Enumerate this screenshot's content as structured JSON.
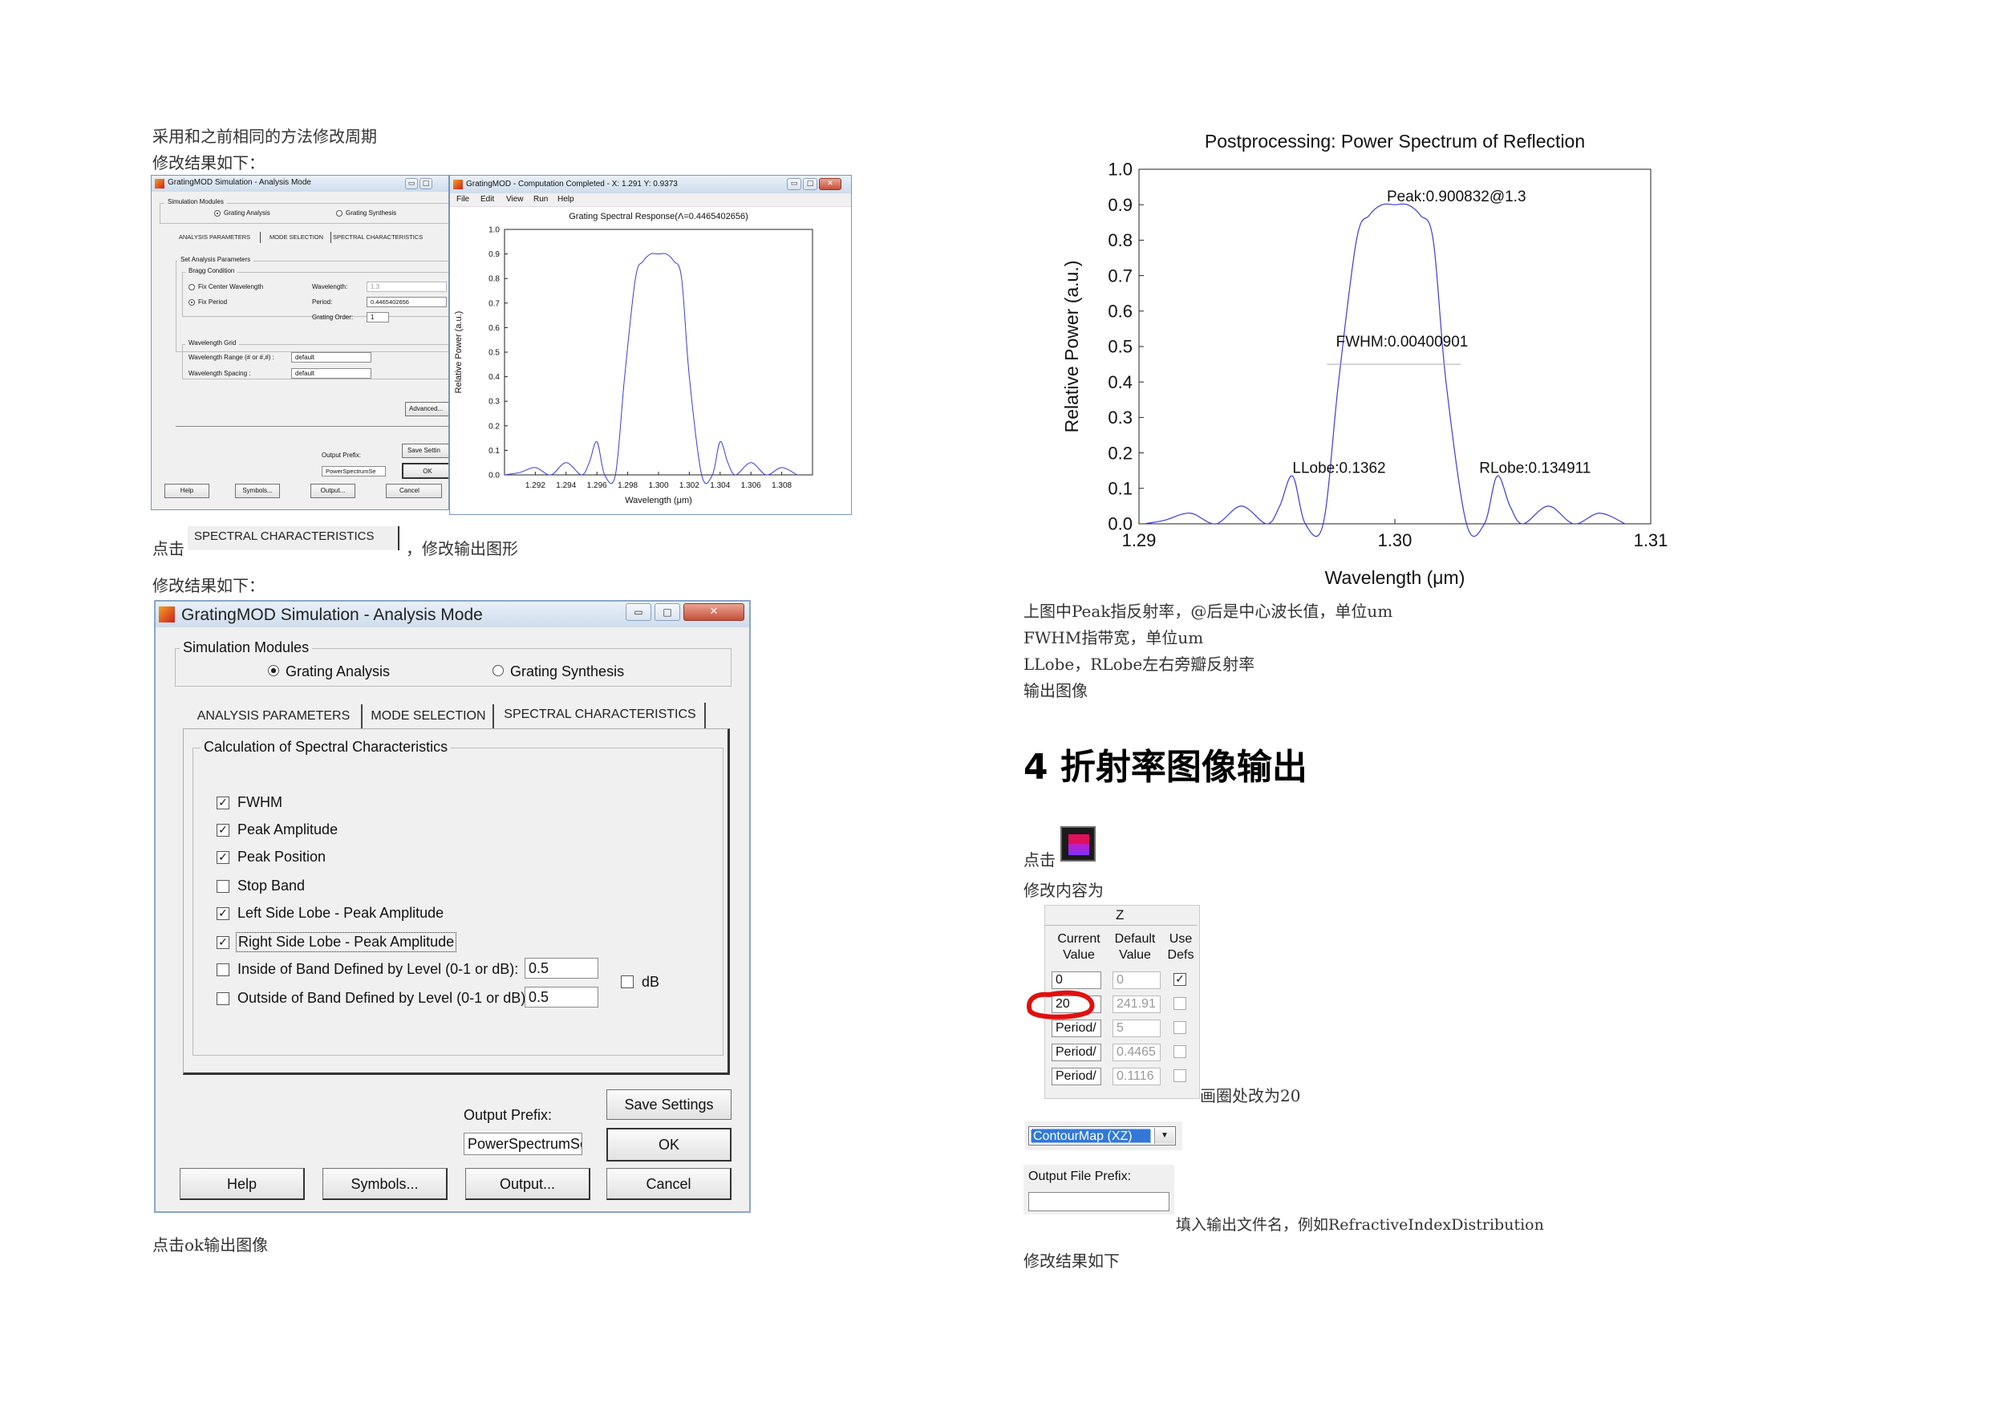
{
  "left": {
    "para1": "采用和之前相同的方法修改周期",
    "para2": "修改结果如下：",
    "click_prefix": "点击",
    "spectral_button": "SPECTRAL CHARACTERISTICS",
    "click_suffix": "，修改输出图形",
    "para3": "修改结果如下：",
    "para4": "点击ok输出图像"
  },
  "small_analysis_window": {
    "title": "GratingMOD Simulation - Analysis Mode",
    "modules_label": "Simulation Modules",
    "radio_analysis": "Grating Analysis",
    "radio_synthesis": "Grating Synthesis",
    "tabs": [
      "ANALYSIS PARAMETERS",
      "MODE SELECTION",
      "SPECTRAL CHARACTERISTICS"
    ],
    "set_params": "Set Analysis Parameters",
    "bragg": "Bragg Condition",
    "fix_center": "Fix Center Wavelength",
    "fix_period": "Fix Period",
    "wavelength_label": "Wavelength:",
    "wavelength_value": "1.3",
    "period_label": "Period:",
    "period_value": "0.4465402656",
    "order_label": "Grating Order:",
    "order_value": "1",
    "grid_label": "Wavelength Grid",
    "range_label": "Wavelength Range (# or #,#) :",
    "range_value": "default",
    "spacing_label": "Wavelength Spacing :",
    "spacing_value": "default",
    "advanced": "Advanced...",
    "output_prefix_label": "Output Prefix:",
    "output_prefix_value": "PowerSpectrumSe",
    "save": "Save Settin",
    "ok": "OK",
    "help": "Help",
    "symbols": "Symbols...",
    "output": "Output...",
    "cancel": "Cancel"
  },
  "computation_window": {
    "title": "GratingMOD - Computation Completed - X: 1.291  Y: 0.9373",
    "menu": [
      "File",
      "Edit",
      "View",
      "Run",
      "Help"
    ],
    "chart_title": "Grating Spectral Response(Λ=0.4465402656)",
    "xlabel": "Wavelength (μm)",
    "ylabel": "Relative Power (a.u.)"
  },
  "big_window": {
    "title": "GratingMOD Simulation - Analysis Mode",
    "modules_label": "Simulation Modules",
    "radio_analysis": "Grating Analysis",
    "radio_synthesis": "Grating Synthesis",
    "tabs": [
      "ANALYSIS PARAMETERS",
      "MODE SELECTION",
      "SPECTRAL CHARACTERISTICS"
    ],
    "calc_label": "Calculation of Spectral Characteristics",
    "checks": [
      {
        "label": "FWHM",
        "checked": true
      },
      {
        "label": "Peak Amplitude",
        "checked": true
      },
      {
        "label": "Peak Position",
        "checked": true
      },
      {
        "label": "Stop Band",
        "checked": false
      },
      {
        "label": "Left Side Lobe - Peak Amplitude",
        "checked": true
      },
      {
        "label": "Right Side Lobe - Peak Amplitude",
        "checked": true
      },
      {
        "label": "Inside of Band Defined by Level (0-1 or dB):",
        "checked": false
      },
      {
        "label": "Outside of Band Defined by Level (0-1 or dB):",
        "checked": false
      }
    ],
    "inside_value": "0.5",
    "outside_value": "0.5",
    "db_label": "dB",
    "output_prefix_label": "Output Prefix:",
    "output_prefix_value": "PowerSpectrumSe",
    "save": "Save Settings",
    "ok": "OK",
    "help": "Help",
    "symbols": "Symbols...",
    "output": "Output...",
    "cancel": "Cancel"
  },
  "right": {
    "note1": "上图中Peak指反射率，@后是中心波长值，单位um",
    "note2": "FWHM指带宽，单位um",
    "note3": "LLobe，RLobe左右旁瓣反射率",
    "note4": "输出图像",
    "heading": "4 折射率图像输出",
    "click_prefix": "点击",
    "modify": "修改内容为",
    "circle_note": "画圈处改为20",
    "dropdown_value": "ContourMap (XZ)",
    "output_file_label": "Output File Prefix:",
    "fill_note": "填入输出文件名，例如RefractiveIndexDistribution",
    "result": "修改结果如下"
  },
  "z_table": {
    "title": "Z",
    "headers": [
      "Current Value",
      "Default Value",
      "Use Defs"
    ],
    "rows": [
      {
        "current": "0",
        "default": "0",
        "use": true
      },
      {
        "current": "20",
        "default": "241.91",
        "use": false
      },
      {
        "current": "Period/",
        "default": "5",
        "use": false
      },
      {
        "current": "Period/",
        "default": "0.4465",
        "use": false
      },
      {
        "current": "Period/",
        "default": "0.1116",
        "use": false
      }
    ]
  },
  "chart_data": [
    {
      "type": "line",
      "title": "Grating Spectral Response(Λ=0.4465402656)",
      "xlabel": "Wavelength (μm)",
      "ylabel": "Relative Power (a.u.)",
      "xlim": [
        1.29,
        1.31
      ],
      "ylim": [
        0,
        1.0
      ],
      "xticks": [
        "1.292",
        "1.294",
        "1.296",
        "1.298",
        "1.300",
        "1.302",
        "1.304",
        "1.306",
        "1.308"
      ],
      "yticks": [
        "0.0",
        "0.1",
        "0.2",
        "0.3",
        "0.4",
        "0.5",
        "0.6",
        "0.7",
        "0.8",
        "0.9",
        "1.0"
      ],
      "color": "#3b3bdc",
      "x": [
        1.29,
        1.291,
        1.292,
        1.293,
        1.294,
        1.295,
        1.2955,
        1.296,
        1.2965,
        1.2972,
        1.2978,
        1.2985,
        1.299,
        1.2995,
        1.3,
        1.3005,
        1.301,
        1.3015,
        1.302,
        1.3028,
        1.3035,
        1.304,
        1.3045,
        1.305,
        1.306,
        1.307,
        1.308,
        1.309
      ],
      "y": [
        0.0,
        0.01,
        0.03,
        0.0,
        0.05,
        0.0,
        0.05,
        0.135,
        0.0,
        0.0,
        0.4,
        0.8,
        0.87,
        0.9,
        0.9,
        0.9,
        0.87,
        0.8,
        0.4,
        0.0,
        0.0,
        0.135,
        0.05,
        0.0,
        0.05,
        0.0,
        0.03,
        0.0
      ]
    },
    {
      "type": "line",
      "title": "Postprocessing: Power Spectrum of Reflection",
      "xlabel": "Wavelength (μm)",
      "ylabel": "Relative Power (a.u.)",
      "xlim": [
        1.29,
        1.31
      ],
      "ylim": [
        0.0,
        1.0
      ],
      "xticks": [
        "1.29",
        "1.30",
        "1.31"
      ],
      "yticks": [
        "0.0",
        "0.1",
        "0.2",
        "0.3",
        "0.4",
        "0.5",
        "0.6",
        "0.7",
        "0.8",
        "0.9",
        "1.0"
      ],
      "color": "#3b3bdc",
      "x": [
        1.2902,
        1.291,
        1.292,
        1.293,
        1.294,
        1.295,
        1.2955,
        1.296,
        1.2965,
        1.2972,
        1.2978,
        1.2985,
        1.299,
        1.2995,
        1.3,
        1.3005,
        1.301,
        1.3015,
        1.302,
        1.3028,
        1.3035,
        1.304,
        1.3045,
        1.305,
        1.306,
        1.307,
        1.308,
        1.309
      ],
      "y": [
        0.0,
        0.01,
        0.03,
        0.0,
        0.05,
        0.0,
        0.05,
        0.135,
        0.0,
        0.0,
        0.4,
        0.8,
        0.87,
        0.9,
        0.9,
        0.9,
        0.87,
        0.8,
        0.4,
        0.0,
        0.0,
        0.135,
        0.05,
        0.0,
        0.05,
        0.0,
        0.03,
        0.0
      ],
      "annotations": [
        "Peak:0.900832@1.3",
        "FWHM:0.00400901",
        "LLobe:0.1362",
        "RLobe:0.134911"
      ]
    }
  ]
}
